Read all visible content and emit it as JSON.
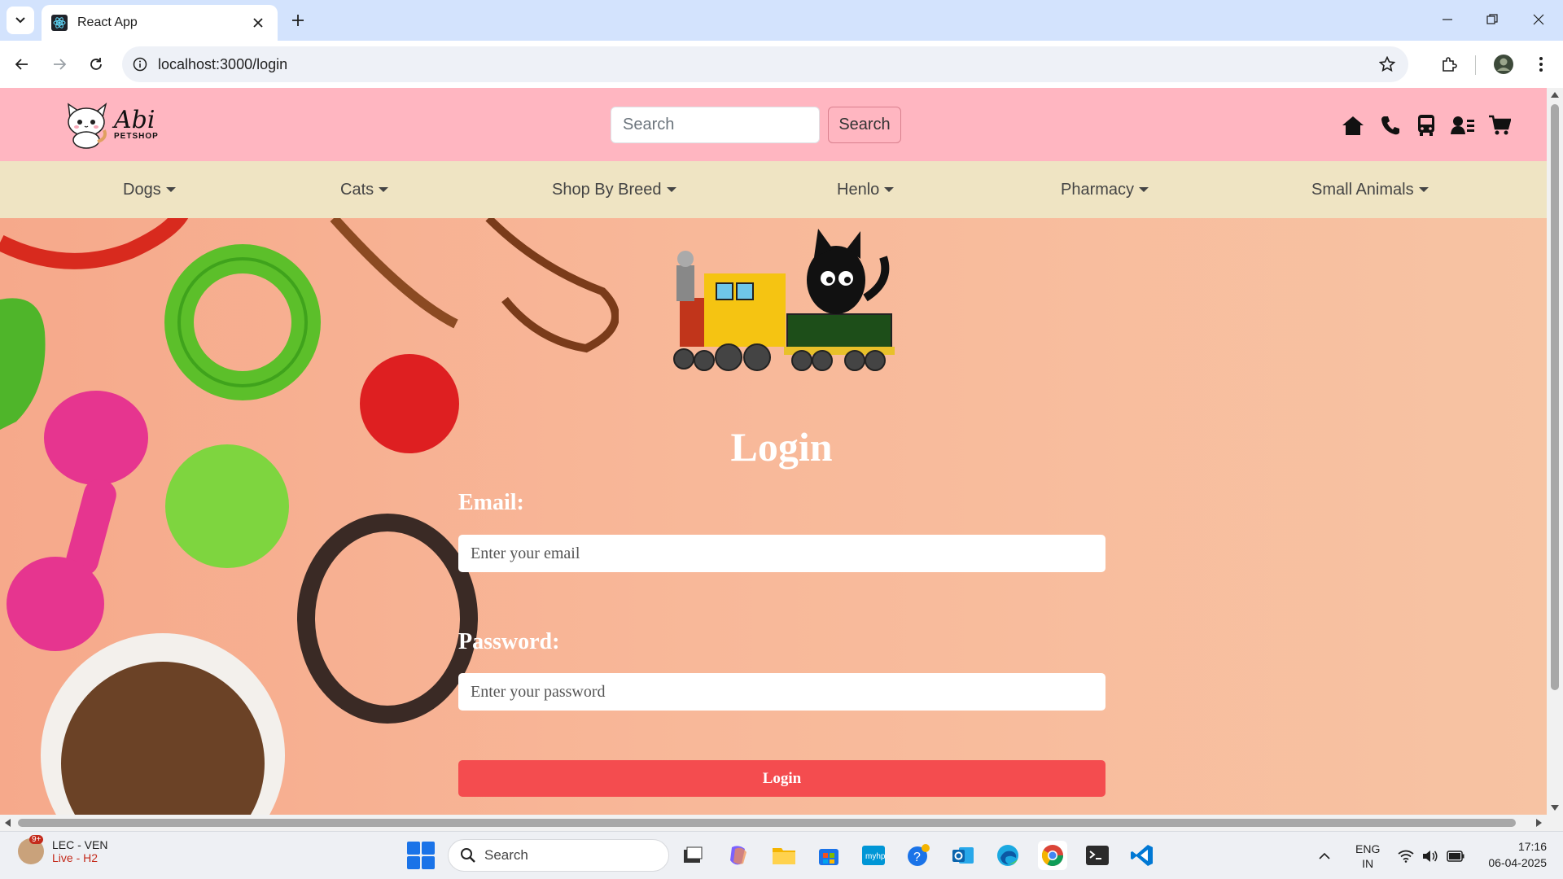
{
  "browser": {
    "tab_title": "React App",
    "url": "localhost:3000/login"
  },
  "header": {
    "logo_script": "Abi",
    "logo_sub": "PETSHOP",
    "search_placeholder": "Search",
    "search_button": "Search"
  },
  "nav": {
    "items": [
      {
        "label": "Dogs"
      },
      {
        "label": "Cats"
      },
      {
        "label": "Shop By Breed"
      },
      {
        "label": "Henlo"
      },
      {
        "label": "Pharmacy"
      },
      {
        "label": "Small Animals"
      }
    ]
  },
  "login": {
    "title": "Login",
    "email_label": "Email:",
    "email_placeholder": "Enter your email",
    "password_label": "Password:",
    "password_placeholder": "Enter your password",
    "submit_label": "Login"
  },
  "taskbar": {
    "weather_badge": "9+",
    "weather_line1": "LEC - VEN",
    "weather_line2": "Live - H2",
    "search_label": "Search",
    "lang_line1": "ENG",
    "lang_line2": "IN",
    "time": "17:16",
    "date": "06-04-2025"
  },
  "colors": {
    "header_bg": "#ffb6c1",
    "nav_bg": "#efe4c3",
    "login_button": "#f44c4f"
  }
}
